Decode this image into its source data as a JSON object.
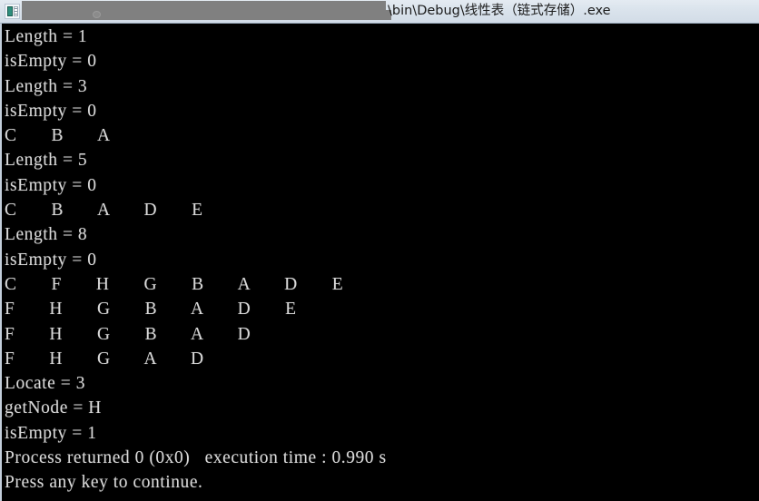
{
  "titlebar": {
    "icon_name": "application-icon",
    "redacted_path_placeholder": "",
    "title": "\\bin\\Debug\\线性表（链式存储）.exe"
  },
  "console": {
    "background_color": "#000000",
    "text_color": "#d9d9d9",
    "column_width_chars": 8,
    "lines": [
      "Length = 1",
      "isEmpty = 0",
      "Length = 3",
      "isEmpty = 0",
      "C       B       A",
      "Length = 5",
      "isEmpty = 0",
      "C       B       A       D       E",
      "Length = 8",
      "isEmpty = 0",
      "C       F       H       G       B       A       D       E",
      "F       H       G       B       A       D       E",
      "F       H       G       B       A       D",
      "F       H       G       A       D",
      "Locate = 3",
      "getNode = H",
      "isEmpty = 1",
      "Process returned 0 (0x0)   execution time : 0.990 s",
      "Press any key to continue."
    ],
    "full_text": "Length = 1\nisEmpty = 0\nLength = 3\nisEmpty = 0\nC       B       A\nLength = 5\nisEmpty = 0\nC       B       A       D       E\nLength = 8\nisEmpty = 0\nC       F       H       G       B       A       D       E\nF       H       G       B       A       D       E\nF       H       G       B       A       D\nF       H       G       A       D\nLocate = 3\ngetNode = H\nisEmpty = 1\nProcess returned 0 (0x0)   execution time : 0.990 s\nPress any key to continue."
  },
  "program_output": {
    "length_values": [
      1,
      3,
      5,
      8
    ],
    "isEmpty_values": [
      0,
      0,
      0,
      0,
      1
    ],
    "list_states": [
      [
        "C",
        "B",
        "A"
      ],
      [
        "C",
        "B",
        "A",
        "D",
        "E"
      ],
      [
        "C",
        "F",
        "H",
        "G",
        "B",
        "A",
        "D",
        "E"
      ],
      [
        "F",
        "H",
        "G",
        "B",
        "A",
        "D",
        "E"
      ],
      [
        "F",
        "H",
        "G",
        "B",
        "A",
        "D"
      ],
      [
        "F",
        "H",
        "G",
        "A",
        "D"
      ]
    ],
    "locate": 3,
    "getNode": "H",
    "process_return_code": "0 (0x0)",
    "execution_time": "0.990 s",
    "exit_prompt": "Press any key to continue."
  }
}
